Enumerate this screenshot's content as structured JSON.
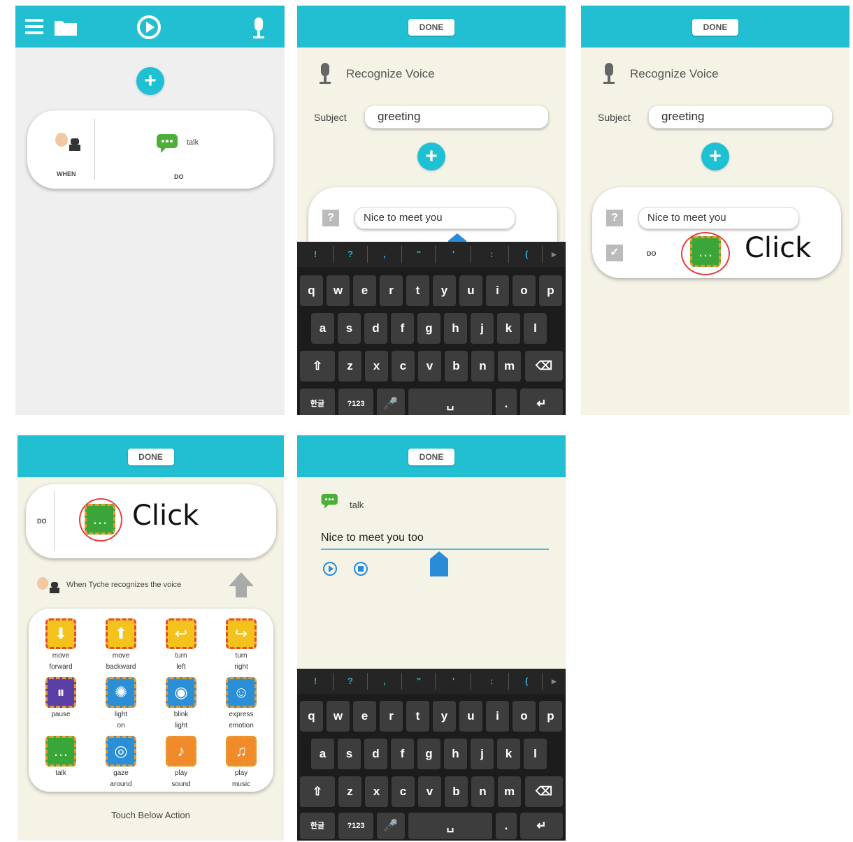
{
  "p1": {
    "header_icons": [
      "menu-icon",
      "folder-icon",
      "play-icon",
      "mic-icon"
    ],
    "card": {
      "when_label": "WHEN",
      "do_label": "DO",
      "action_label": "talk"
    }
  },
  "p2": {
    "done": "DONE",
    "title": "Recognize Voice",
    "subject_label": "Subject",
    "subject_value": "greeting",
    "question": "?",
    "answer": "Nice to meet you",
    "keyboard": {
      "symbols": [
        "!",
        "?",
        ",",
        "\"",
        "'",
        ":",
        "(",
        "▸"
      ],
      "row1": [
        "q",
        "w",
        "e",
        "r",
        "t",
        "y",
        "u",
        "i",
        "o",
        "p"
      ],
      "row2": [
        "a",
        "s",
        "d",
        "f",
        "g",
        "h",
        "j",
        "k",
        "l"
      ],
      "row3": [
        "z",
        "x",
        "c",
        "v",
        "b",
        "n",
        "m"
      ],
      "lang": "한글",
      "num": "?123"
    }
  },
  "p3": {
    "done": "DONE",
    "title": "Recognize Voice",
    "subject_label": "Subject",
    "subject_value": "greeting",
    "question": "?",
    "answer": "Nice to meet you",
    "check": "✓",
    "do_label": "DO",
    "click": "Click"
  },
  "p4": {
    "done": "DONE",
    "do_label": "DO",
    "click": "Click",
    "when_text": "When Tyche recognizes the voice",
    "actions": [
      {
        "label1": "move",
        "label2": "forward",
        "color": "#f4c21c",
        "glyph": "⬇"
      },
      {
        "label1": "move",
        "label2": "backward",
        "color": "#f4c21c",
        "glyph": "⬆"
      },
      {
        "label1": "turn",
        "label2": "left",
        "color": "#f4c21c",
        "glyph": "↩"
      },
      {
        "label1": "turn",
        "label2": "right",
        "color": "#f4c21c",
        "glyph": "↪"
      },
      {
        "label1": "pause",
        "label2": "",
        "color": "#5b3fa6",
        "glyph": "⏸"
      },
      {
        "label1": "light",
        "label2": "on",
        "color": "#2a8fd6",
        "glyph": "✺"
      },
      {
        "label1": "blink",
        "label2": "light",
        "color": "#2a8fd6",
        "glyph": "◉"
      },
      {
        "label1": "express",
        "label2": "emotion",
        "color": "#2a8fd6",
        "glyph": "☺"
      },
      {
        "label1": "talk",
        "label2": "",
        "color": "#3aa63a",
        "glyph": "…"
      },
      {
        "label1": "gaze",
        "label2": "around",
        "color": "#2a8fd6",
        "glyph": "◎"
      },
      {
        "label1": "play",
        "label2": "sound",
        "color": "#f08a2a",
        "glyph": "♪"
      },
      {
        "label1": "play",
        "label2": "music",
        "color": "#f08a2a",
        "glyph": "♫"
      }
    ],
    "footer": "Touch Below Action"
  },
  "p5": {
    "done": "DONE",
    "title": "talk",
    "text_value": "Nice to meet you too",
    "keyboard": {
      "symbols": [
        "!",
        "?",
        ",",
        "\"",
        "'",
        ":",
        "(",
        "▸"
      ],
      "row1": [
        "q",
        "w",
        "e",
        "r",
        "t",
        "y",
        "u",
        "i",
        "o",
        "p"
      ],
      "row2": [
        "a",
        "s",
        "d",
        "f",
        "g",
        "h",
        "j",
        "k",
        "l"
      ],
      "row3": [
        "z",
        "x",
        "c",
        "v",
        "b",
        "n",
        "m"
      ],
      "lang": "한글",
      "num": "?123"
    }
  },
  "colors": {
    "header": "#22bfd2",
    "accent": "#1ec0d4",
    "panel_bg": "#f5f3e6",
    "highlight": "#e53d3d"
  }
}
